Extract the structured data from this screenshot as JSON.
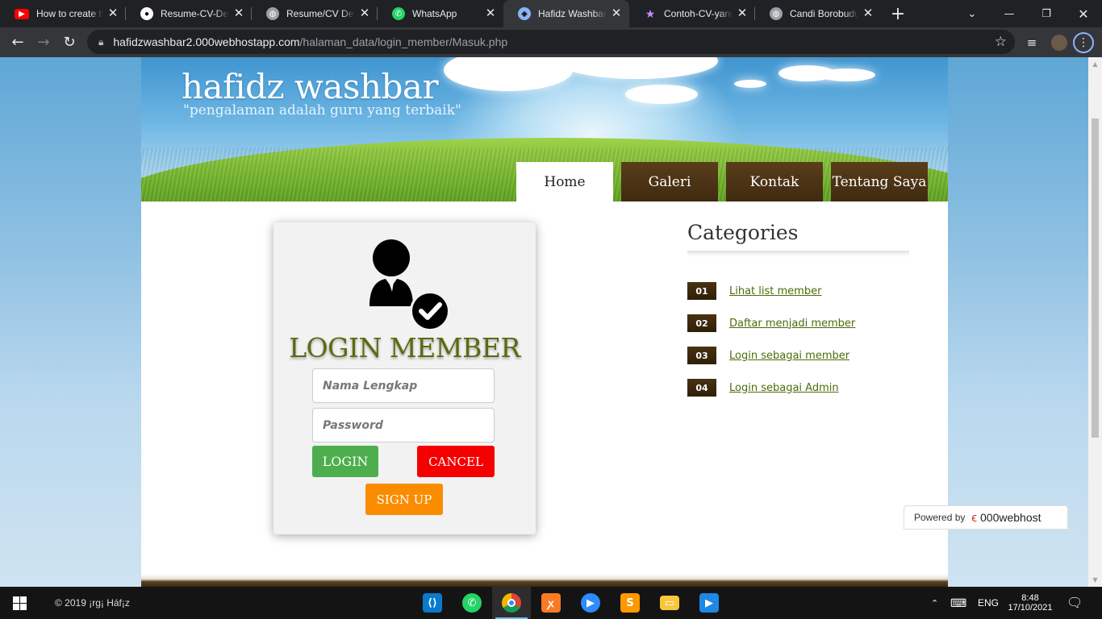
{
  "browser": {
    "tabs": [
      {
        "title": "How to create the",
        "favicon": "youtube-icon",
        "color": "#ff0000"
      },
      {
        "title": "Resume-CV-Desi",
        "favicon": "github-icon",
        "color": "#ffffff"
      },
      {
        "title": "Resume/CV Desi",
        "favicon": "globe-icon",
        "color": "#9aa0a6"
      },
      {
        "title": "WhatsApp",
        "favicon": "whatsapp-icon",
        "color": "#25d366"
      },
      {
        "title": "Hafidz Washbar",
        "favicon": "site-icon",
        "color": "#8ab4f8"
      },
      {
        "title": "Contoh-CV-yang",
        "favicon": "star-icon",
        "color": "#c58af9"
      },
      {
        "title": "Candi Borobudur",
        "favicon": "globe-icon",
        "color": "#9aa0a6"
      }
    ],
    "url_host": "hafidzwashbar2.000webhostapp.com",
    "url_path": "/halaman_data/login_member/Masuk.php"
  },
  "site": {
    "title": "hafidz washbar",
    "tagline": "\"pengalaman adalah guru yang terbaik\"",
    "menu": [
      {
        "label": "Home"
      },
      {
        "label": "Galeri"
      },
      {
        "label": "Kontak"
      },
      {
        "label": "Tentang Saya"
      }
    ]
  },
  "login": {
    "heading": "LOGIN MEMBER",
    "name_placeholder": "Nama Lengkap",
    "password_placeholder": "Password",
    "login_label": "LOGIN",
    "cancel_label": "CANCEL",
    "signup_label": "SIGN UP"
  },
  "categories": {
    "title": "Categories",
    "items": [
      {
        "num": "01",
        "label": "Lihat list member"
      },
      {
        "num": "02",
        "label": "Daftar menjadi member"
      },
      {
        "num": "03",
        "label": "Login sebagai member"
      },
      {
        "num": "04",
        "label": "Login sebagai Admin"
      }
    ]
  },
  "powered": {
    "label": "Powered by",
    "brand": "000webhost"
  },
  "taskbar": {
    "copyright": "© 2019 ¡rg¡ Háf¡z",
    "lang": "ENG",
    "time": "8:48",
    "date": "17/10/2021"
  },
  "colors": {
    "accent_green": "#4cae4c",
    "cancel_red": "#f50000",
    "signup_orange": "#fb8c00",
    "heading_olive": "#5a6b10",
    "menu_brown": "#3f2a10"
  }
}
